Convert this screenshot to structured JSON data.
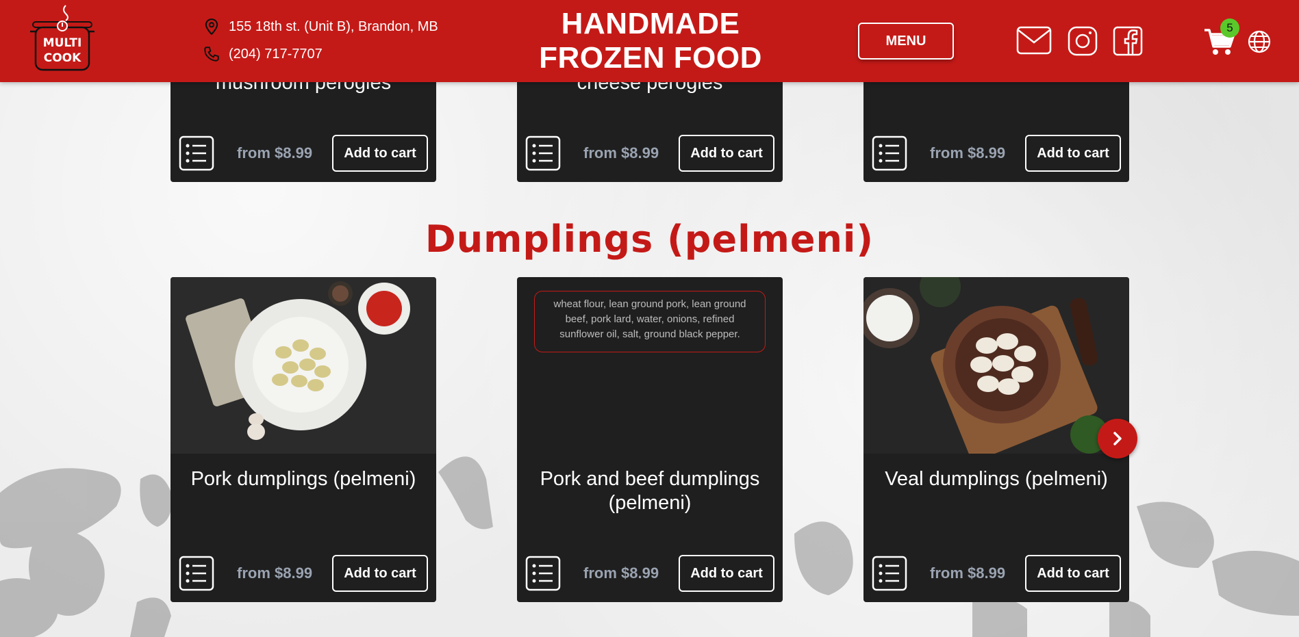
{
  "header": {
    "logo_text_line1": "MULTI",
    "logo_text_line2": "COOK",
    "address": "155 18th st. (Unit B), Brandon, MB",
    "phone": "(204) 717-7707",
    "brand_line1": "HANDMADE",
    "brand_line2": "FROZEN FOOD",
    "menu_label": "MENU",
    "cart_count": "5"
  },
  "top_cards": [
    {
      "title": "mushroom perogies",
      "price": "from $8.99",
      "button": "Add to cart"
    },
    {
      "title": "cheese perogies",
      "price": "from $8.99",
      "button": "Add to cart"
    },
    {
      "title": "",
      "price": "from $8.99",
      "button": "Add to cart"
    }
  ],
  "section": {
    "title": "Dumplings (pelmeni)"
  },
  "bottom_cards": [
    {
      "title": "Pork dumplings (pelmeni)",
      "price": "from $8.99",
      "button": "Add to cart"
    },
    {
      "title": "Pork and beef dumplings (pelmeni)",
      "price": "from $8.99",
      "button": "Add to cart",
      "ingredients": "wheat flour, lean ground pork, lean ground beef, pork lard, water, onions, refined sunflower oil, salt, ground black pepper."
    },
    {
      "title": "Veal dumplings (pelmeni)",
      "price": "from $8.99",
      "button": "Add to cart"
    }
  ],
  "colors": {
    "brand_red": "#c41a17",
    "card_bg": "#1f1f1f",
    "price_gray": "#9aa3b1",
    "badge_green": "#5ac82a"
  },
  "icons": [
    "location-pin-icon",
    "phone-icon",
    "mail-icon",
    "instagram-icon",
    "facebook-icon",
    "cart-icon",
    "globe-icon",
    "list-icon",
    "chevron-right-icon"
  ]
}
